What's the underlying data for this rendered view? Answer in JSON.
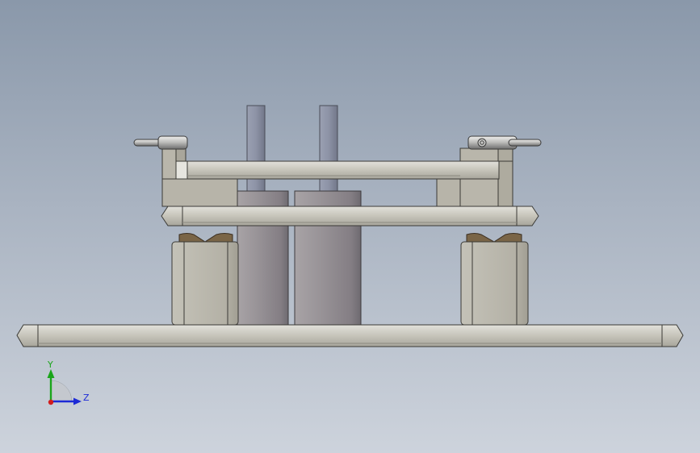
{
  "viewport": {
    "background_top": "#8a98aa",
    "background_bottom": "#cdd3dc"
  },
  "triad": {
    "y_label": "Y",
    "z_label": "Z",
    "y_color": "#1aa51a",
    "z_color": "#1c2ad6",
    "x_color": "#d21c1c"
  },
  "model": {
    "metal_color": "#c9c7bd",
    "cylinder_color": "#8f8a8e",
    "rod_color": "#8e93a4",
    "pad_color": "#7a6547"
  }
}
